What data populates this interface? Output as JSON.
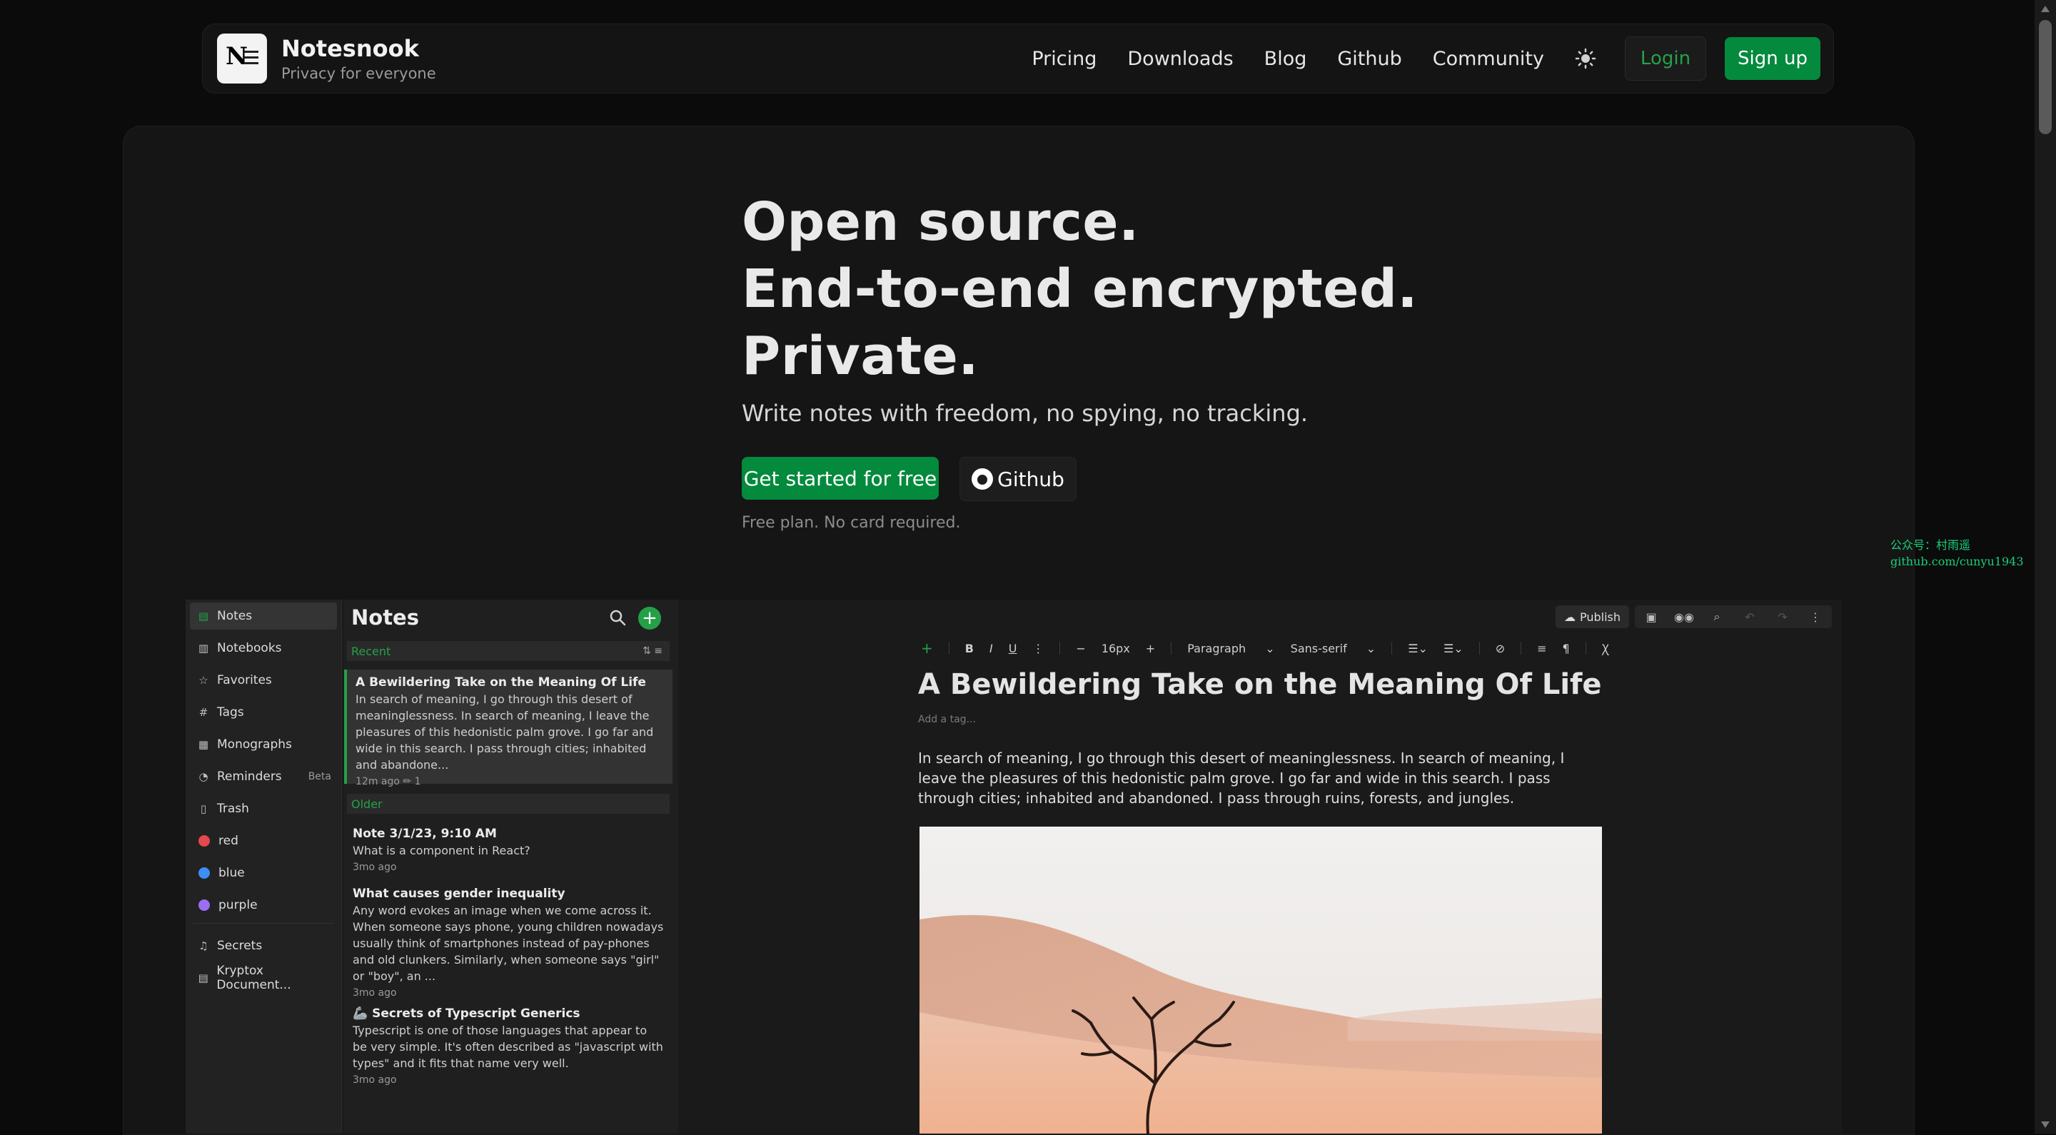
{
  "nav": {
    "brand_name": "Notesnook",
    "brand_tagline": "Privacy for everyone",
    "links": [
      "Pricing",
      "Downloads",
      "Blog",
      "Github",
      "Community"
    ],
    "login": "Login",
    "signup": "Sign up"
  },
  "hero": {
    "line1": "Open source.",
    "line2": "End-to-end encrypted.",
    "line3": "Private.",
    "subtitle": "Write notes with freedom, no spying, no tracking.",
    "cta_primary": "Get started for free",
    "cta_secondary": "Github",
    "note": "Free plan. No card required."
  },
  "watermark": {
    "line1": "公众号：村雨遥",
    "line2": "github.com/cunyu1943"
  },
  "app": {
    "sidebar": [
      {
        "icon": "note-icon",
        "glyph": "▤",
        "label": "Notes"
      },
      {
        "icon": "notebook-icon",
        "glyph": "▥",
        "label": "Notebooks"
      },
      {
        "icon": "star-icon",
        "glyph": "☆",
        "label": "Favorites"
      },
      {
        "icon": "hash-icon",
        "glyph": "#",
        "label": "Tags"
      },
      {
        "icon": "monograph-icon",
        "glyph": "▦",
        "label": "Monographs"
      },
      {
        "icon": "alarm-icon",
        "glyph": "⏰",
        "label": "Reminders",
        "badge": "Beta"
      },
      {
        "icon": "trash-icon",
        "glyph": "🗑",
        "label": "Trash"
      },
      {
        "color": "#e5484d",
        "label": "red"
      },
      {
        "color": "#3e8ef7",
        "label": "blue"
      },
      {
        "color": "#9b6ef3",
        "label": "purple"
      },
      {
        "icon": "shortcut-icon",
        "glyph": "♫",
        "label": "Secrets"
      },
      {
        "icon": "shortcut-icon",
        "glyph": "▤",
        "label": "Kryptox Document..."
      }
    ],
    "list": {
      "title": "Notes",
      "group_recent": "Recent",
      "group_older": "Older",
      "notes": [
        {
          "title": "A Bewildering Take on the Meaning Of Life",
          "body": "In search of meaning, I go through this desert of meaninglessness. In search of meaning, I leave the pleasures of this hedonistic palm grove. I go far and wide in this search. I pass through cities; inhabited and abandone...",
          "meta": "12m ago  ✏ 1"
        },
        {
          "title": "Note 3/1/23, 9:10 AM",
          "body": "What is a component in React?",
          "meta": "3mo ago"
        },
        {
          "title": "What causes gender inequality",
          "body": "Any word evokes an image when we come across it. When someone says phone, young children nowadays usually think of smartphones instead of pay-phones and old clunkers. Similarly, when someone says \"girl\" or \"boy\", an ...",
          "meta": "3mo ago"
        },
        {
          "title": "🦾 Secrets of Typescript Generics",
          "body": "Typescript is one of those languages that appear to be very simple. It's often described as \"javascript with types\" and it fits that name very well.",
          "meta": "3mo ago"
        }
      ]
    },
    "editor": {
      "publish": "Publish",
      "font_size": "16px",
      "block_type": "Paragraph",
      "font_family": "Sans-serif",
      "title": "A Bewildering Take on the Meaning Of Life",
      "tag_placeholder": "Add a tag...",
      "body": "In search of meaning, I go through this desert of meaninglessness. In search of meaning, I leave the pleasures of this hedonistic palm grove. I go far and wide in this search. I pass through cities; inhabited and abandoned. I pass through ruins, forests, and jungles."
    }
  },
  "colors": {
    "accent": "#048a3d",
    "accent_text": "#24a148",
    "background": "#0b0b0b",
    "panel": "#151515"
  }
}
